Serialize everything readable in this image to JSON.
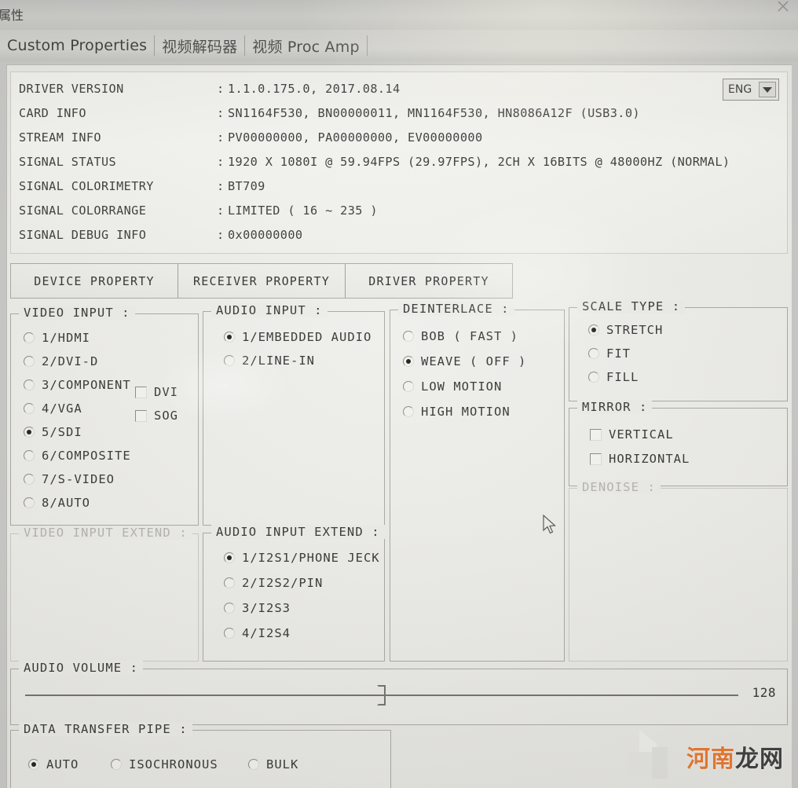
{
  "window": {
    "title": "属性",
    "close_icon": "close-icon"
  },
  "top_tabs": [
    {
      "label": "Custom Properties",
      "active": true
    },
    {
      "label": "视频解码器",
      "active": false
    },
    {
      "label": "视频 Proc Amp",
      "active": false
    }
  ],
  "info": {
    "rows": [
      {
        "label": "DRIVER VERSION",
        "colon": ":",
        "value": "1.1.0.175.0, 2017.08.14"
      },
      {
        "label": "CARD INFO",
        "colon": ":",
        "value": "SN1164F530, BN00000011, MN1164F530, HN8086A12F (USB3.0)"
      },
      {
        "label": "STREAM INFO",
        "colon": ":",
        "value": "PV00000000, PA00000000, EV00000000"
      },
      {
        "label": "SIGNAL STATUS",
        "colon": ":",
        "value": "1920 X 1080I @ 59.94FPS (29.97FPS), 2CH X 16BITS @ 48000HZ (NORMAL)"
      },
      {
        "label": "SIGNAL COLORIMETRY",
        "colon": ":",
        "value": "BT709"
      },
      {
        "label": "SIGNAL COLORRANGE",
        "colon": ":",
        "value": "LIMITED ( 16 ~ 235 )"
      },
      {
        "label": "SIGNAL DEBUG INFO",
        "colon": ":",
        "value": "0x00000000"
      }
    ],
    "language": {
      "value": "ENG",
      "arrow_icon": "chevron-down-icon"
    }
  },
  "property_tabs": [
    {
      "label": "DEVICE PROPERTY"
    },
    {
      "label": "RECEIVER PROPERTY"
    },
    {
      "label": "DRIVER PROPERTY"
    }
  ],
  "groups": {
    "video_input": {
      "legend": "VIDEO INPUT :",
      "options": [
        {
          "label": "1/HDMI",
          "selected": false
        },
        {
          "label": "2/DVI-D",
          "selected": false
        },
        {
          "label": "3/COMPONENT",
          "selected": false
        },
        {
          "label": "4/VGA",
          "selected": false
        },
        {
          "label": "5/SDI",
          "selected": true
        },
        {
          "label": "6/COMPOSITE",
          "selected": false
        },
        {
          "label": "7/S-VIDEO",
          "selected": false
        },
        {
          "label": "8/AUTO",
          "selected": false
        }
      ],
      "checkboxes": [
        {
          "label": "DVI",
          "checked": false
        },
        {
          "label": "SOG",
          "checked": false
        }
      ]
    },
    "video_input_extend": {
      "legend": "VIDEO INPUT EXTEND :",
      "disabled": true,
      "options": []
    },
    "audio_input": {
      "legend": "AUDIO INPUT :",
      "options": [
        {
          "label": "1/EMBEDDED AUDIO",
          "selected": true
        },
        {
          "label": "2/LINE-IN",
          "selected": false
        }
      ]
    },
    "audio_input_extend": {
      "legend": "AUDIO INPUT EXTEND :",
      "options": [
        {
          "label": "1/I2S1/PHONE JECK",
          "selected": true
        },
        {
          "label": "2/I2S2/PIN",
          "selected": false
        },
        {
          "label": "3/I2S3",
          "selected": false
        },
        {
          "label": "4/I2S4",
          "selected": false
        }
      ]
    },
    "deinterlace": {
      "legend": "DEINTERLACE :",
      "options": [
        {
          "label": "BOB ( FAST )",
          "selected": false
        },
        {
          "label": "WEAVE ( OFF )",
          "selected": true
        },
        {
          "label": "LOW MOTION",
          "selected": false
        },
        {
          "label": "HIGH MOTION",
          "selected": false
        }
      ]
    },
    "scale_type": {
      "legend": "SCALE TYPE :",
      "options": [
        {
          "label": "STRETCH",
          "selected": true
        },
        {
          "label": "FIT",
          "selected": false
        },
        {
          "label": "FILL",
          "selected": false
        }
      ]
    },
    "mirror": {
      "legend": "MIRROR :",
      "checkboxes": [
        {
          "label": "VERTICAL",
          "checked": false
        },
        {
          "label": "HORIZONTAL",
          "checked": false
        }
      ]
    },
    "denoise": {
      "legend": "DENOISE :",
      "disabled": true,
      "options": []
    },
    "audio_volume": {
      "legend": "AUDIO VOLUME :",
      "value": "128",
      "min": 0,
      "max": 255,
      "percent": 50
    },
    "data_transfer_pipe": {
      "legend": "DATA TRANSFER PIPE :",
      "options": [
        {
          "label": "AUTO",
          "selected": true
        },
        {
          "label": "ISOCHRONOUS",
          "selected": false
        },
        {
          "label": "BULK",
          "selected": false
        }
      ]
    }
  },
  "watermark": {
    "orange": "河南",
    "dark": "龙网"
  }
}
